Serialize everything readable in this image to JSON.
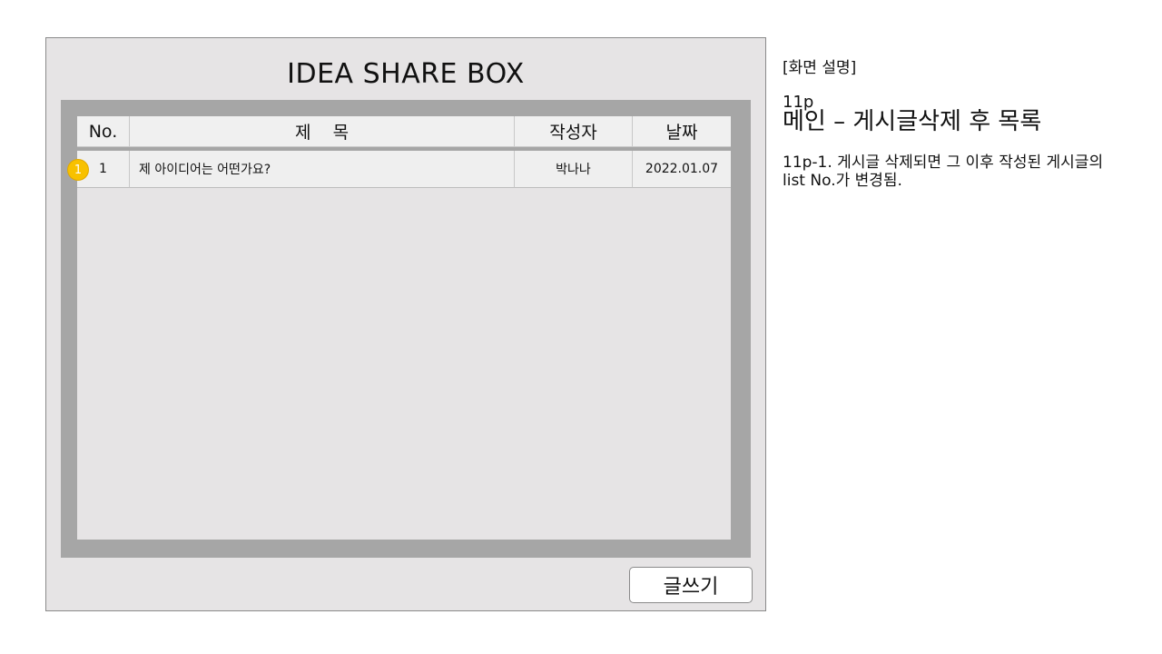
{
  "app": {
    "title": "IDEA SHARE BOX"
  },
  "table": {
    "headers": {
      "no": "No.",
      "subject": "제    목",
      "author": "작성자",
      "date": "날짜"
    },
    "rows": [
      {
        "no": "1",
        "subject": "제 아이디어는 어떤가요?",
        "author": "박나나",
        "date": "2022.01.07"
      }
    ]
  },
  "annotation_badge": "1",
  "write_button": {
    "label": "글쓰기"
  },
  "description": {
    "heading": "[화면 설명]",
    "page": "11p",
    "screen_title": "메인 – 게시글삭제 후 목록",
    "note": "11p-1. 게시글 삭제되면 그 이후 작성된 게시글의 list No.가 변경됨."
  },
  "colors": {
    "badge": "#f8c100",
    "panel": "#e6e4e5",
    "frame": "#a6a6a6"
  }
}
